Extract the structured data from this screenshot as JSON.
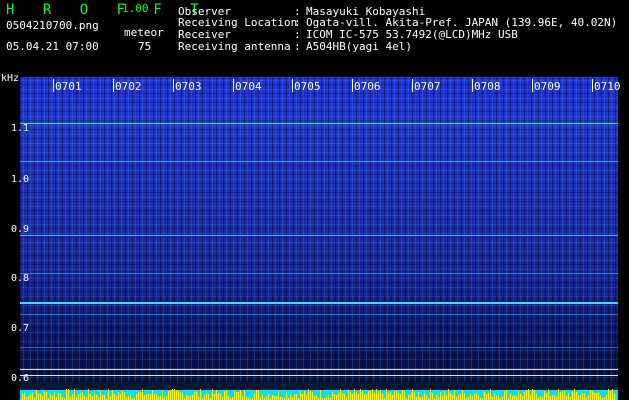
{
  "header": {
    "app_title": "H R O F F T",
    "version": "1.00",
    "filename": "0504210700.png",
    "datetime": "05.04.21 07:00",
    "mode_label": "meteor",
    "count": "75"
  },
  "info": {
    "observer_label": "Observer",
    "observer_value": "Masayuki Kobayashi",
    "location_label": "Receiving Location",
    "location_value": "Ogata-vill. Akita-Pref. JAPAN (139.96E, 40.02N)",
    "receiver_label": "Receiver",
    "receiver_value": "ICOM IC-575 53.7492(@LCD)MHz USB",
    "antenna_label": "Receiving antenna",
    "antenna_value": "A504HB(yagi 4el)",
    "sep": ":"
  },
  "axis": {
    "unit": "kHz",
    "y_ticks": [
      "1.1",
      "1.0",
      "0.9",
      "0.8",
      "0.7",
      "0.6"
    ],
    "x_ticks": [
      "0701",
      "0702",
      "0703",
      "0704",
      "0705",
      "0706",
      "0707",
      "0708",
      "0709",
      "0710"
    ]
  },
  "colors": {
    "title": "#00ff33",
    "text": "#ffffff",
    "spectrum_top": "#1f2fd4",
    "spectrum_bottom": "#0a0f3d",
    "signal": "#00ffff",
    "bars": "#ffff00"
  }
}
